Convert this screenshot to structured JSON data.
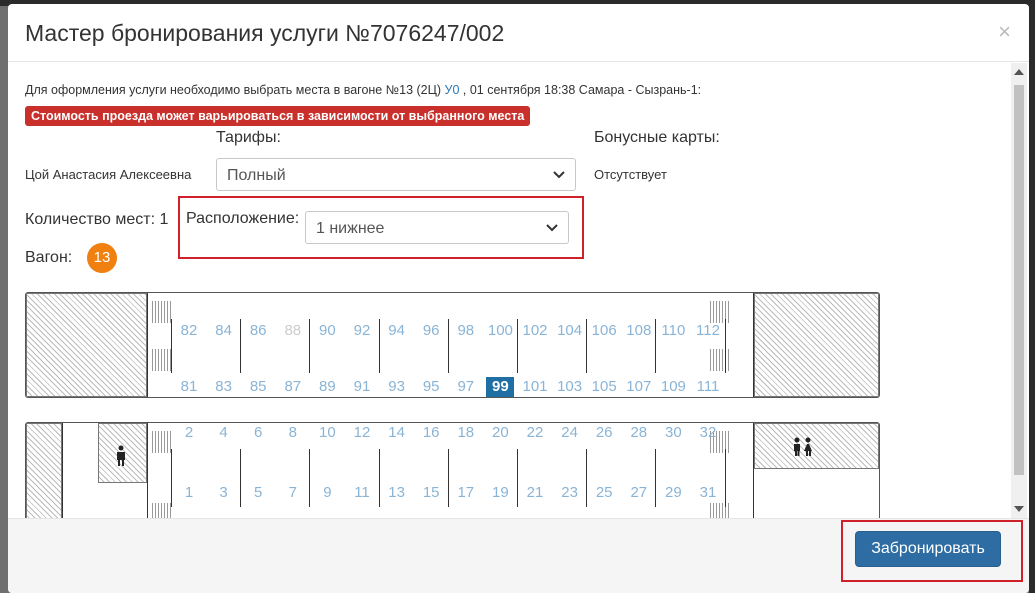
{
  "modal": {
    "title": "Мастер бронирования услуги №7076247/002",
    "close_symbol": "×"
  },
  "info": {
    "prefix": "Для оформления услуги необходимо выбрать места в вагоне №13 (2Ц)",
    "link": "У0",
    "suffix": ", 01 сентября 18:38 Самара - Сызрань-1:",
    "warning": "Стоимость проезда может варьироваться в зависимости от выбранного места"
  },
  "passenger": {
    "name": "Цой Анастасия Алексеевна"
  },
  "tariffs": {
    "label": "Тарифы:",
    "value": "Полный"
  },
  "bonus": {
    "label": "Бонусные карты:",
    "value": "Отсутствует"
  },
  "seats_count": {
    "label": "Количество мест: 1"
  },
  "location": {
    "label": "Расположение:",
    "value": "1 нижнее"
  },
  "wagon": {
    "label": "Вагон:",
    "number": "13"
  },
  "upper_deck": {
    "top_row": [
      "82",
      "84",
      "86",
      "88",
      "90",
      "92",
      "94",
      "96",
      "98",
      "100",
      "102",
      "104",
      "106",
      "108",
      "110",
      "112"
    ],
    "bottom_row": [
      "81",
      "83",
      "85",
      "87",
      "89",
      "91",
      "93",
      "95",
      "97",
      "99",
      "101",
      "103",
      "105",
      "107",
      "109",
      "111"
    ],
    "disabled": [
      "88"
    ],
    "selected": "99"
  },
  "lower_deck": {
    "top_row": [
      "2",
      "4",
      "6",
      "8",
      "10",
      "12",
      "14",
      "16",
      "18",
      "20",
      "22",
      "24",
      "26",
      "28",
      "30",
      "32"
    ],
    "bottom_row": [
      "1",
      "3",
      "5",
      "7",
      "9",
      "11",
      "13",
      "15",
      "17",
      "19",
      "21",
      "23",
      "25",
      "27",
      "29",
      "31"
    ]
  },
  "footer": {
    "book_label": "Забронировать"
  },
  "colors": {
    "accent": "#2e6da4",
    "warning": "#c9302c",
    "wagon_badge": "#f08010",
    "seat_available": "#8ab4d6",
    "seat_selected": "#1f6fa5",
    "highlight_box": "#d0202a"
  },
  "icons": [
    "close-icon",
    "chevron-down-icon",
    "toilet-icon",
    "scroll-up-icon",
    "scroll-down-icon"
  ]
}
